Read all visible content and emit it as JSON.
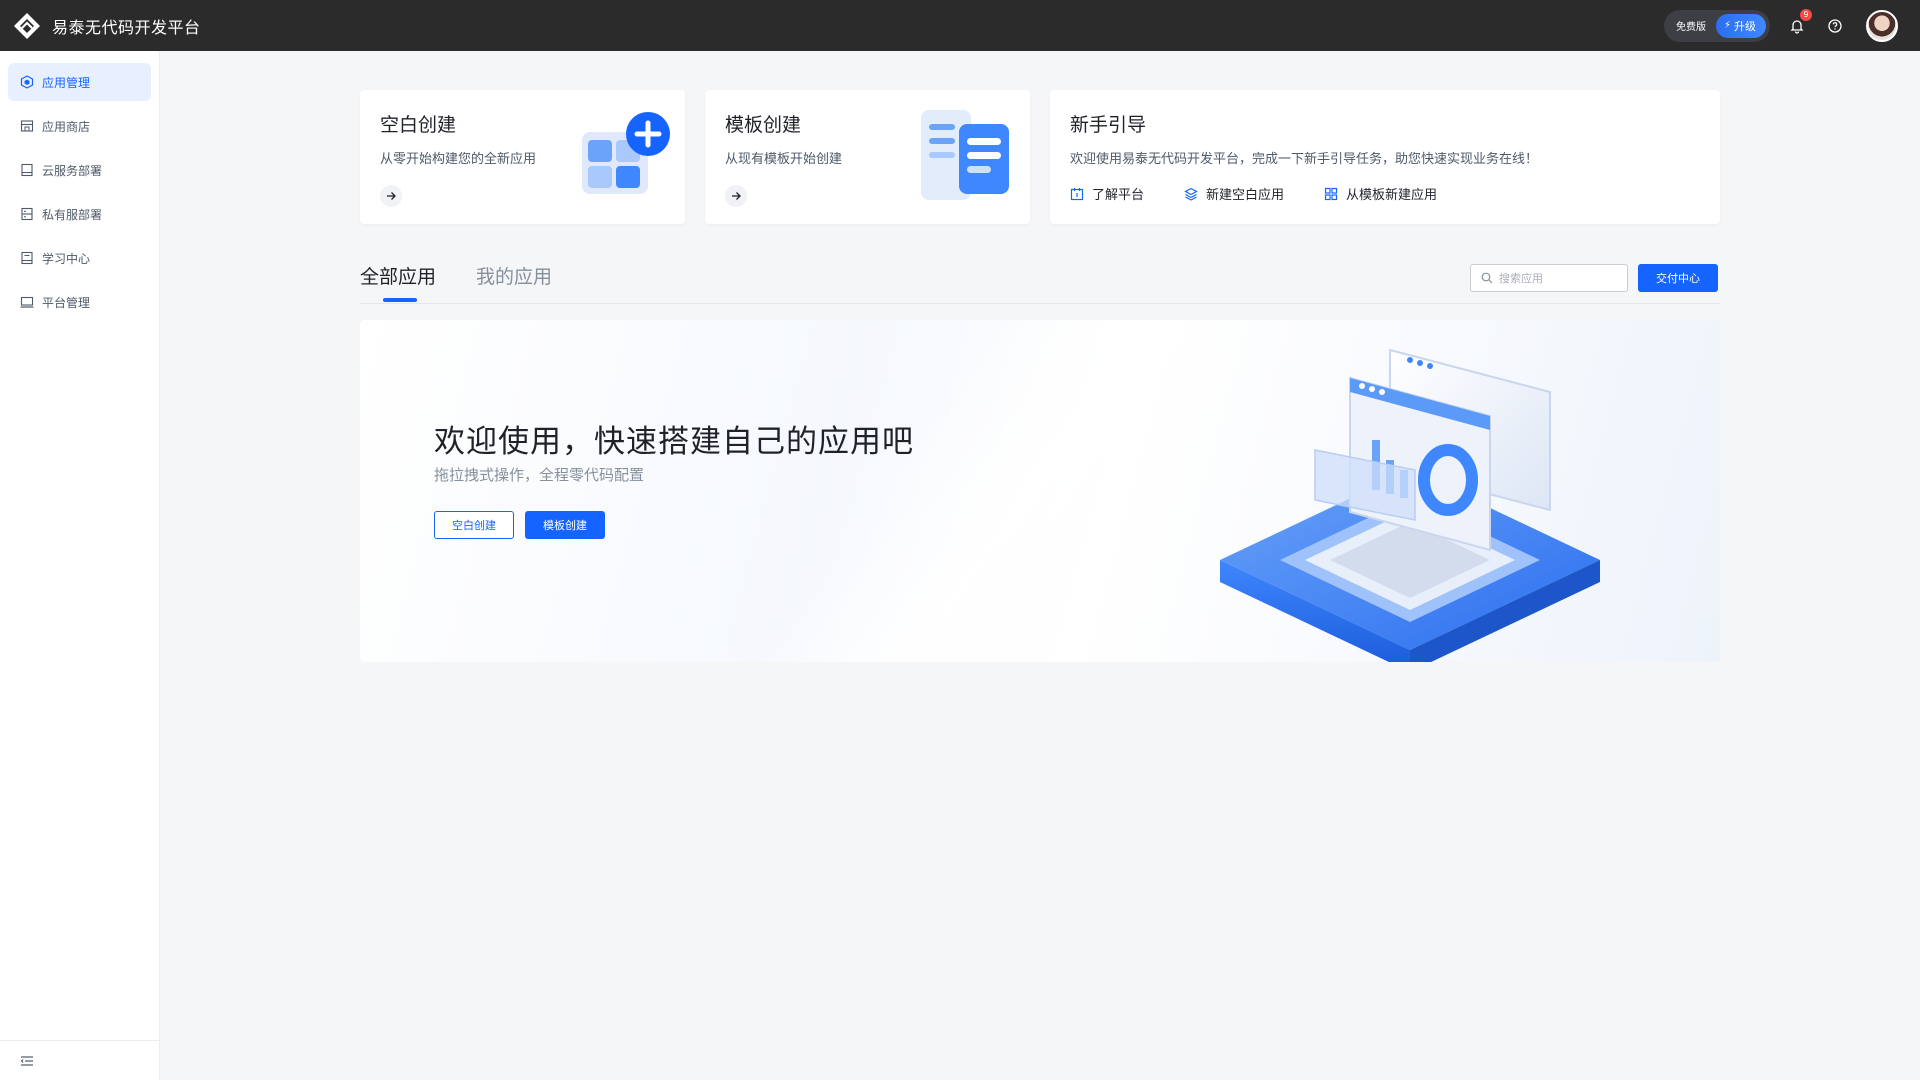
{
  "header": {
    "app_title": "易泰无代码开发平台",
    "plan_label": "免费版",
    "upgrade_label": "升级",
    "notification_count": "9"
  },
  "sidebar": {
    "items": [
      {
        "label": "应用管理",
        "icon": "cube-icon",
        "active": true
      },
      {
        "label": "应用商店",
        "icon": "store-icon",
        "active": false
      },
      {
        "label": "云服务部署",
        "icon": "cloud-box-icon",
        "active": false
      },
      {
        "label": "私有服部署",
        "icon": "server-icon",
        "active": false
      },
      {
        "label": "学习中心",
        "icon": "book-icon",
        "active": false
      },
      {
        "label": "平台管理",
        "icon": "monitor-icon",
        "active": false
      }
    ]
  },
  "cards": {
    "blank": {
      "title": "空白创建",
      "subtitle": "从零开始构建您的全新应用"
    },
    "template": {
      "title": "模板创建",
      "subtitle": "从现有模板开始创建"
    },
    "guide": {
      "title": "新手引导",
      "subtitle": "欢迎使用易泰无代码开发平台，完成一下新手引导任务，助您快速实现业务在线！",
      "links": [
        "了解平台",
        "新建空白应用",
        "从模板新建应用"
      ]
    }
  },
  "tabs": {
    "all": "全部应用",
    "mine": "我的应用"
  },
  "search": {
    "placeholder": "搜索应用",
    "value": ""
  },
  "delivery_button": "交付中心",
  "banner": {
    "title": "欢迎使用，快速搭建自己的应用吧",
    "subtitle": "拖拉拽式操作，全程零代码配置",
    "blank_button": "空白创建",
    "template_button": "模板创建"
  },
  "colors": {
    "primary": "#1664ff",
    "topbar": "#2b2b2b",
    "page_bg": "#f5f6f8",
    "active_nav_bg": "#e8f0ff"
  }
}
